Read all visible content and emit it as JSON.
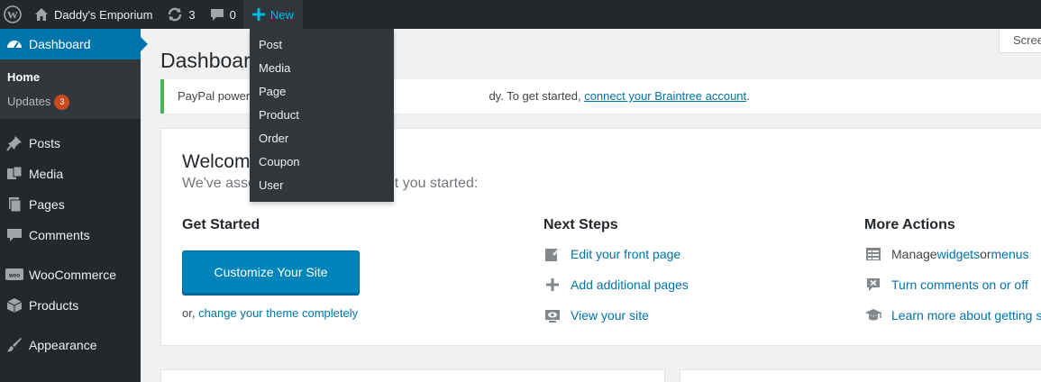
{
  "admin_bar": {
    "wp_logo_icon": "wordpress-logo-icon",
    "site_name": "Daddy's Emporium",
    "updates_count": "3",
    "comments_count": "0",
    "new_label": "New",
    "accent_color": "#00b9eb"
  },
  "new_menu": {
    "items": [
      "Post",
      "Media",
      "Page",
      "Product",
      "Order",
      "Coupon",
      "User"
    ]
  },
  "sidebar": {
    "dashboard_label": "Dashboard",
    "home_label": "Home",
    "updates_label": "Updates",
    "updates_badge": "3",
    "items": [
      {
        "label": "Posts",
        "icon": "pin-icon"
      },
      {
        "label": "Media",
        "icon": "media-icon"
      },
      {
        "label": "Pages",
        "icon": "pages-icon"
      },
      {
        "label": "Comments",
        "icon": "comment-icon"
      },
      {
        "label": "WooCommerce",
        "icon": "woocommerce-icon"
      },
      {
        "label": "Products",
        "icon": "box-icon"
      },
      {
        "label": "Appearance",
        "icon": "brush-icon"
      }
    ]
  },
  "screen_options_label": "Scree",
  "page_title": "Dashboard",
  "notice": {
    "text_before": "PayPal powere",
    "text_after": "dy. To get started, ",
    "link": "connect your Braintree account",
    "period": "."
  },
  "welcome": {
    "title": "Welcom",
    "about": "We've asse",
    "about_end": "et you started:",
    "get_started": {
      "heading": "Get Started",
      "button": "Customize Your Site",
      "or_prefix": "or, ",
      "or_link": "change your theme completely"
    },
    "next_steps": {
      "heading": "Next Steps",
      "items": [
        {
          "label": "Edit your front page",
          "icon": "edit-icon"
        },
        {
          "label": "Add additional pages",
          "icon": "plus-icon"
        },
        {
          "label": "View your site",
          "icon": "view-icon"
        }
      ]
    },
    "more_actions": {
      "heading": "More Actions",
      "manage_prefix": "Manage ",
      "widgets_link": "widgets",
      "or_word": " or ",
      "menus_link": "menus",
      "comments_link": "Turn comments on or off",
      "learn_link": "Learn more about getting s"
    }
  }
}
